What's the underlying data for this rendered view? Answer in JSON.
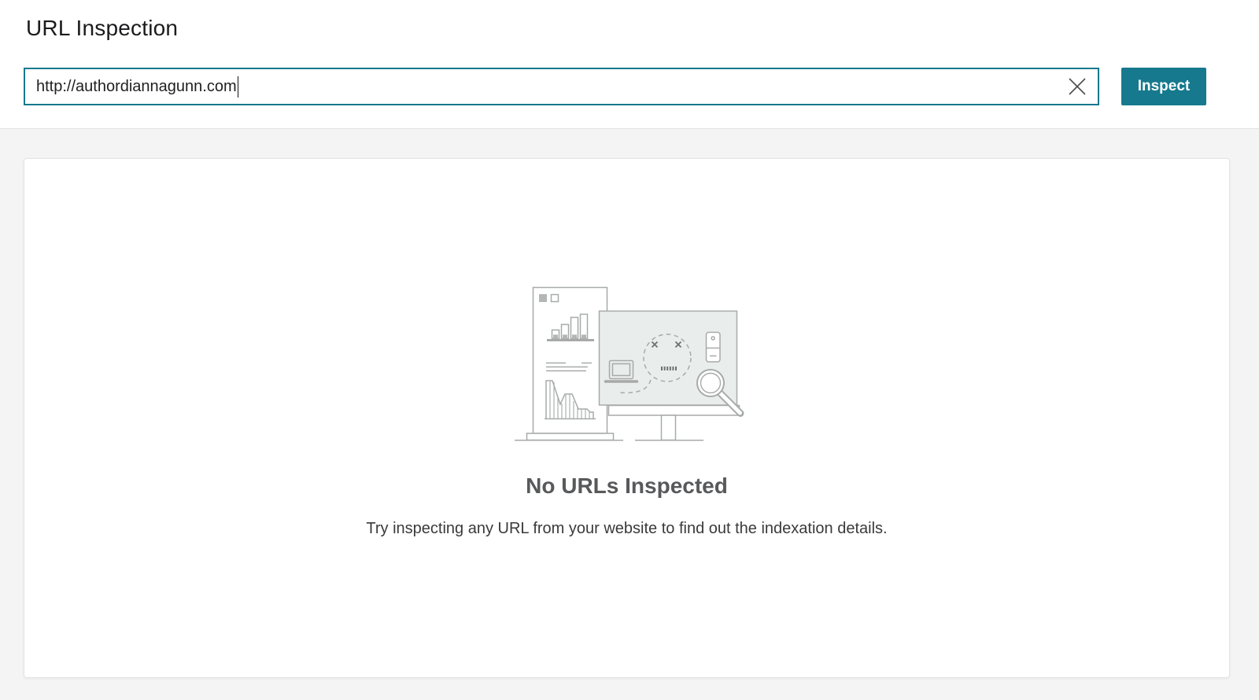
{
  "page": {
    "title": "URL Inspection"
  },
  "inspect_bar": {
    "url_value": "http://authordiannagunn.com",
    "clear_icon": "close-x",
    "inspect_button_label": "Inspect"
  },
  "empty_state": {
    "heading": "No URLs Inspected",
    "description": "Try inspecting any URL from your website to find out the indexation details.",
    "illustration": "monitor-with-dead-face-magnifier-and-chart-banner"
  },
  "colors": {
    "accent_teal": "#16798E",
    "page_bg": "#F4F4F4",
    "card_border": "#E4E4E4",
    "heading_gray": "#58595B",
    "body_text": "#3A3A3A",
    "ill_stroke": "#A7AAA9",
    "ill_fill": "#E9EDEB"
  }
}
